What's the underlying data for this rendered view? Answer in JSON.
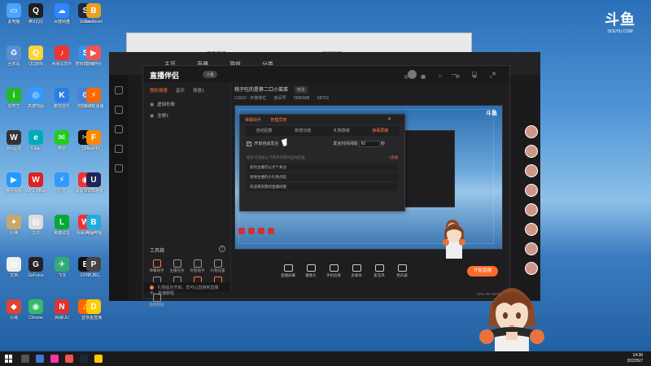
{
  "desktop": {
    "icons": [
      {
        "label": "此电脑",
        "color": "#4aa3ff",
        "glyph": "▭"
      },
      {
        "label": "腾讯QQ",
        "color": "#1f1f1f",
        "glyph": "Q"
      },
      {
        "label": "百度网盘",
        "color": "#2f86ff",
        "glyph": "☁"
      },
      {
        "label": "Steam",
        "color": "#1b2838",
        "glyph": "S"
      },
      {
        "label": "Bandicam",
        "color": "#e8a020",
        "glyph": "B"
      },
      {
        "label": "回收站",
        "color": "#5a8fd0",
        "glyph": "♻"
      },
      {
        "label": "QQ游戏",
        "color": "#ffd33a",
        "glyph": "Q"
      },
      {
        "label": "网易云音乐",
        "color": "#e33",
        "glyph": "♪"
      },
      {
        "label": "搜狗输入法",
        "color": "#3a8ee6",
        "glyph": "S"
      },
      {
        "label": "直播伴侣",
        "color": "#e55",
        "glyph": "▶"
      },
      {
        "label": "爱奇艺",
        "color": "#2b2",
        "glyph": "i"
      },
      {
        "label": "高德地图",
        "color": "#39f",
        "glyph": "◎"
      },
      {
        "label": "酷狗音乐",
        "color": "#2a7de1",
        "glyph": "K"
      },
      {
        "label": "控制面板",
        "color": "#4a7fd6",
        "glyph": "⚙"
      },
      {
        "label": "游戏加速器",
        "color": "#f60",
        "glyph": "⚡"
      },
      {
        "label": "Win驱动",
        "color": "#333",
        "glyph": "W"
      },
      {
        "label": "Edge",
        "color": "#0ab",
        "glyph": "e"
      },
      {
        "label": "微信",
        "color": "#2c2",
        "glyph": "✉"
      },
      {
        "label": "剪映",
        "color": "#111",
        "glyph": "✂"
      },
      {
        "label": "Flash中心",
        "color": "#f80",
        "glyph": "F"
      },
      {
        "label": "腾讯视频",
        "color": "#29f",
        "glyph": "▶"
      },
      {
        "label": "WPS Office",
        "color": "#d22",
        "glyph": "W"
      },
      {
        "label": "迅雷",
        "color": "#39f",
        "glyph": "⚡"
      },
      {
        "label": "网易云游戏",
        "color": "#e33",
        "glyph": "◉"
      },
      {
        "label": "UU加速器",
        "color": "#225",
        "glyph": "U"
      },
      {
        "label": "原神",
        "color": "#c9a66b",
        "glyph": "✦"
      },
      {
        "label": "文件",
        "color": "#ddd",
        "glyph": "▤"
      },
      {
        "label": "英雄联盟",
        "color": "#0a3",
        "glyph": "L"
      },
      {
        "label": "Wallpaper",
        "color": "#e33",
        "glyph": "W"
      },
      {
        "label": "哔哩哔哩",
        "color": "#2ad",
        "glyph": "B"
      },
      {
        "label": "文档",
        "color": "#eee",
        "glyph": "▤"
      },
      {
        "label": "GeForce",
        "color": "#222",
        "glyph": "G"
      },
      {
        "label": "飞书",
        "color": "#3a7",
        "glyph": "✈"
      },
      {
        "label": "EPIC",
        "color": "#111",
        "glyph": "E"
      },
      {
        "label": "PUBG",
        "color": "#444",
        "glyph": "P"
      },
      {
        "label": "火绒",
        "color": "#d43",
        "glyph": "◆"
      },
      {
        "label": "Chrome",
        "color": "#3b6",
        "glyph": "◉"
      },
      {
        "label": "网易UU",
        "color": "#d33",
        "glyph": "N"
      },
      {
        "label": "音乐",
        "color": "#f60",
        "glyph": "♫"
      },
      {
        "label": "斗鱼直播",
        "color": "#fc0",
        "glyph": "D"
      }
    ]
  },
  "douyu_logo": {
    "mark": "斗鱼",
    "text": "DOUYU.COM"
  },
  "bg_window": {
    "address": "正在连接",
    "title": "欢迎页面"
  },
  "back_app": {
    "nav": [
      "主页",
      "直播",
      "游戏",
      "分类"
    ]
  },
  "companion": {
    "logo": "直播伴侣",
    "badge": "斗鱼",
    "window_buttons": "— ▢ ✕",
    "tabs": [
      "我的场景",
      "音乐",
      "场景1"
    ],
    "scenes": [
      "虚拟形象",
      "全屏1"
    ],
    "tools_title": "工具箱",
    "tools": [
      {
        "label": "弹幕助手",
        "hot": true
      },
      {
        "label": "主播任务",
        "hot": false
      },
      {
        "label": "房管助手",
        "hot": false
      },
      {
        "label": "礼物设置",
        "hot": false
      },
      {
        "label": "多人连麦",
        "hot": false
      },
      {
        "label": "推荐助手",
        "hot": false
      },
      {
        "label": "滤镜",
        "hot": true
      },
      {
        "label": "贴图素材",
        "hot": true
      },
      {
        "label": "直播数据",
        "hot": false
      }
    ],
    "status": "礼物提示开启，您可以直接到直播中，直播教程",
    "room_title": "桃子吃的是第二口小菜菜",
    "room_btn": "修改",
    "sub_info": [
      "CSGO - 天梯排位",
      "房间号",
      "5585888",
      "58793"
    ],
    "bottom_tools": [
      "直播屏幕",
      "摄像头",
      "手机投屏",
      "多媒体",
      "麦克风",
      "扬声器"
    ],
    "start_live": "开始直播",
    "cpu": "CPU 0% 00:00:00"
  },
  "dialog": {
    "head": [
      "弹幕助手",
      "管理员表"
    ],
    "tabs": [
      "自动回复",
      "新增功能",
      "礼物感谢",
      "弹幕屏蔽"
    ],
    "enable_label": "开启自动发言",
    "interval_label": "发言时间间隔",
    "interval_value": "60",
    "interval_unit": "秒",
    "hint": "最多可添加以下条件内容的自动回复",
    "add": "+添加",
    "items": [
      "新的主播可以点个关注",
      "谢谢主播的小礼物点起",
      "欢迎来到我的直播间哦"
    ]
  },
  "clock": {
    "time": "14:36",
    "date": "2022/5/7"
  }
}
